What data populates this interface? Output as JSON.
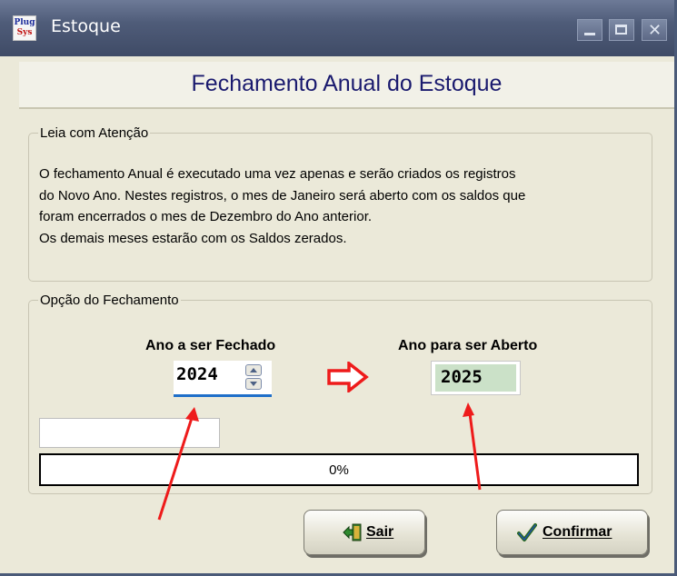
{
  "window": {
    "title": "Estoque",
    "logo_text_top": "Plug",
    "logo_text_bottom": "Sys"
  },
  "header": {
    "title": "Fechamento Anual do Estoque"
  },
  "info": {
    "legend": "Leia com Atenção",
    "lines": [
      "O fechamento Anual é executado uma vez apenas e serão criados os registros",
      "do Novo Ano. Nestes registros, o mes de Janeiro será aberto com os saldos que",
      "foram encerrados o mes de Dezembro do Ano anterior.",
      "Os demais meses estarão com os Saldos zerados."
    ]
  },
  "options": {
    "legend": "Opção do Fechamento",
    "close_year_label": "Ano a ser Fechado",
    "close_year_value": "2024",
    "open_year_label": "Ano para ser Aberto",
    "open_year_value": "2025",
    "status_text": ""
  },
  "progress": {
    "percent": 0,
    "label": "0%"
  },
  "buttons": {
    "exit_label": "Sair",
    "confirm_label": "Confirmar"
  },
  "colors": {
    "accent_arrow": "#ee1b1b",
    "title_color": "#1a1a6e",
    "open_field_bg": "#cbe1c8",
    "focus_underline": "#1f6fc9"
  }
}
